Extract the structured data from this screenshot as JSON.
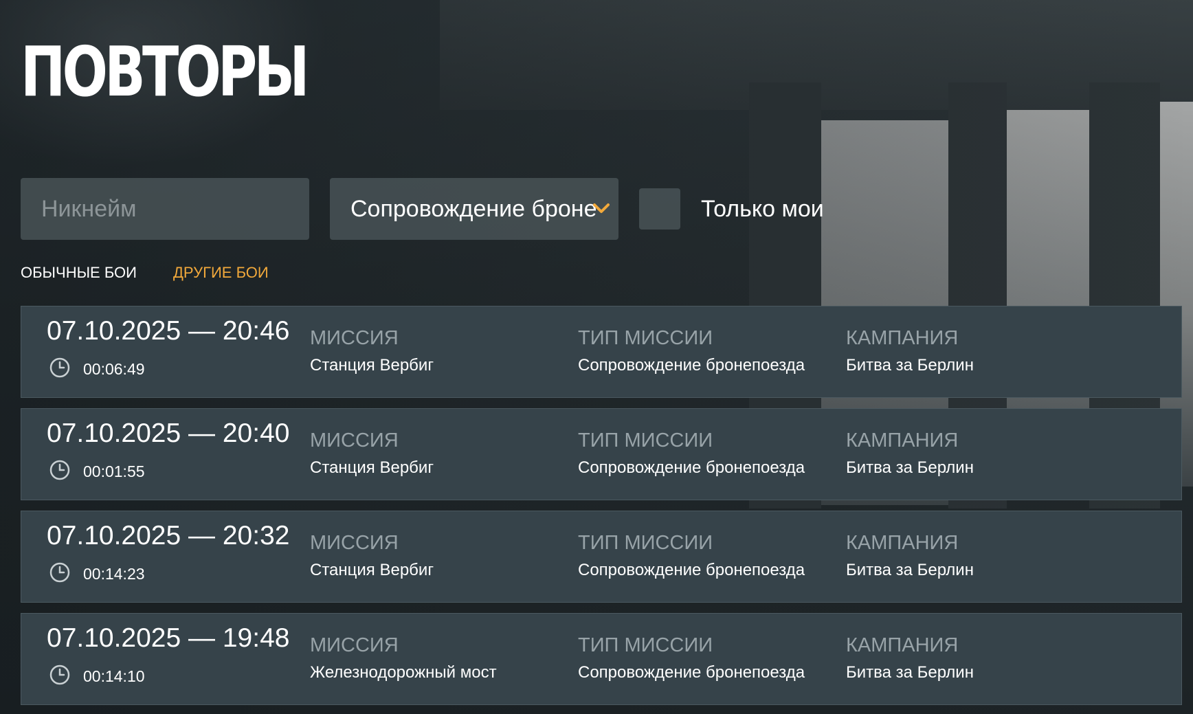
{
  "page": {
    "title": "ПОВТОРЫ"
  },
  "filters": {
    "nickname_placeholder": "Никнейм",
    "nickname_value": "",
    "mission_type_selected": "Сопровождение бронепоезда",
    "only_mine_label": "Только мои",
    "only_mine_checked": false
  },
  "tabs": [
    {
      "label": "ОБЫЧНЫЕ БОИ",
      "active": false
    },
    {
      "label": "ДРУГИЕ БОИ",
      "active": true
    }
  ],
  "colors": {
    "accent": "#f2a93b",
    "row_bg": "#36434a",
    "label_gray": "#98a3a8"
  },
  "columns": {
    "mission": "МИССИЯ",
    "mission_type": "ТИП МИССИИ",
    "campaign": "КАМПАНИЯ"
  },
  "replays": [
    {
      "datetime": "07.10.2025 — 20:46",
      "duration": "00:06:49",
      "mission": "Станция Вербиг",
      "mission_type": "Сопровождение бронепоезда",
      "campaign": "Битва за Берлин"
    },
    {
      "datetime": "07.10.2025 — 20:40",
      "duration": "00:01:55",
      "mission": "Станция Вербиг",
      "mission_type": "Сопровождение бронепоезда",
      "campaign": "Битва за Берлин"
    },
    {
      "datetime": "07.10.2025 — 20:32",
      "duration": "00:14:23",
      "mission": "Станция Вербиг",
      "mission_type": "Сопровождение бронепоезда",
      "campaign": "Битва за Берлин"
    },
    {
      "datetime": "07.10.2025 — 19:48",
      "duration": "00:14:10",
      "mission": "Железнодорожный мост",
      "mission_type": "Сопровождение бронепоезда",
      "campaign": "Битва за Берлин"
    }
  ],
  "icons": {
    "duration": "clock-icon",
    "dropdown": "chevron-down-icon"
  }
}
